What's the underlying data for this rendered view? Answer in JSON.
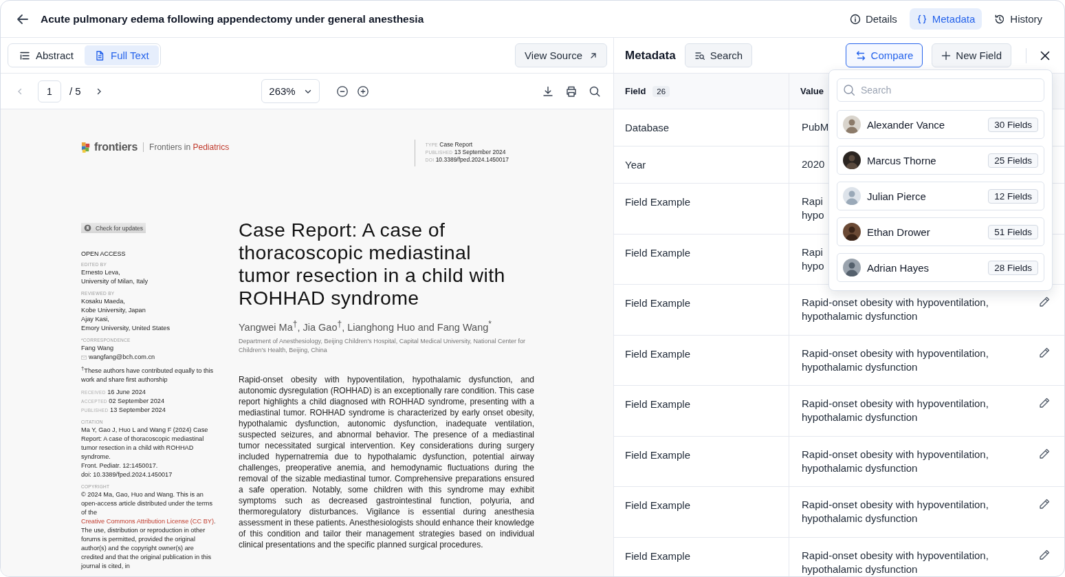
{
  "window": {
    "title": "Acute pulmonary edema following appendectomy under general anesthesia"
  },
  "view_tabs": [
    {
      "label": "Details",
      "selected": false
    },
    {
      "label": "Metadata",
      "selected": true
    },
    {
      "label": "History",
      "selected": false
    }
  ],
  "document_tabs": [
    {
      "label": "Abstract",
      "selected": false
    },
    {
      "label": "Full Text",
      "selected": true
    }
  ],
  "view_source": "View Source",
  "pager": {
    "page": "1",
    "total": "/ 5",
    "zoom": "263%"
  },
  "article": {
    "brand": "frontiers",
    "journal_prefix": "Frontiers in",
    "journal_name": "Pediatrics",
    "meta": [
      {
        "label": "TYPE",
        "value": "Case Report"
      },
      {
        "label": "PUBLISHED",
        "value": "13 September 2024"
      },
      {
        "label": "DOI",
        "value": "10.3389/fped.2024.1450017"
      }
    ],
    "check_updates": "Check for updates",
    "open_access": "OPEN ACCESS",
    "sections": [
      {
        "heading": "EDITED BY",
        "lines": [
          "Ernesto Leva,",
          "University of Milan, Italy"
        ]
      },
      {
        "heading": "REVIEWED BY",
        "lines": [
          "Kosaku Maeda,",
          "Kobe University, Japan",
          "Ajay Kasi,",
          "Emory University, United States"
        ]
      },
      {
        "heading": "*CORRESPONDENCE",
        "lines": [
          "Fang Wang"
        ]
      }
    ],
    "email": "wangfang@bch.com.cn",
    "footnote": "$^{†}$These authors have contributed equally to this work and share first authorship",
    "dates": [
      {
        "label": "RECEIVED",
        "value": "16 June 2024"
      },
      {
        "label": "ACCEPTED",
        "value": "02 September 2024"
      },
      {
        "label": "PUBLISHED",
        "value": "13 September 2024"
      }
    ],
    "citation": {
      "heading": "CITATION",
      "lines": [
        "Ma Y, Gao J, Huo L and Wang F (2024) Case Report: A case of thoracoscopic mediastinal tumor resection in a child with ROHHAD syndrome.",
        "Front. Pediatr. 12:1450017.",
        "doi: 10.3389/fped.2024.1450017"
      ]
    },
    "copyright": {
      "heading": "COPYRIGHT",
      "before": "© 2024 Ma, Gao, Huo and Wang. This is an open-access article distributed under the terms of the",
      "link": "Creative Commons Attribution License (CC BY)",
      "after": ". The use, distribution or reproduction in other forums is permitted, provided the original author(s) and the copyright owner(s) are credited and that the original publication in this journal is cited, in"
    },
    "title": "Case Report: A case of thoracoscopic mediastinal tumor resection in a child with ROHHAD syndrome",
    "authors": "Yangwei Ma$^{†}$, Jia Gao$^{†}$, Lianghong Huo and Fang Wang$^{*}$",
    "affiliation": "Department of Anesthesiology, Beijing Children's Hospital, Capital Medical University, National Center for Children's Health, Beijing, China",
    "abstract": "Rapid-onset obesity with hypoventilation, hypothalamic dysfunction, and autonomic dysregulation (ROHHAD) is an exceptionally rare condition. This case report highlights a child diagnosed with ROHHAD syndrome, presenting with a mediastinal tumor. ROHHAD syndrome is characterized by early onset obesity, hypothalamic dysfunction, autonomic dysfunction, inadequate ventilation, suspected seizures, and abnormal behavior. The presence of a mediastinal tumor necessitated surgical intervention. Key considerations during surgery included hypernatremia due to hypothalamic dysfunction, potential airway challenges, preoperative anemia, and hemodynamic fluctuations during the removal of the sizable mediastinal tumor. Comprehensive preparations ensured a safe operation. Notably, some children with this syndrome may exhibit symptoms such as decreased gastrointestinal function, polyuria, and thermoregulatory disturbances. Vigilance is essential during anesthesia assessment in these patients. Anesthesiologists should enhance their knowledge of this condition and tailor their management strategies based on individual clinical presentations and the specific planned surgical procedures."
  },
  "metadata_panel": {
    "title": "Metadata",
    "search": "Search",
    "compare": {
      "label": "Compare",
      "selected": true
    },
    "new_field": "New Field",
    "columns": [
      {
        "label": "Field",
        "count": "26"
      },
      {
        "label": "Value"
      }
    ],
    "rows": [
      {
        "field": "Database",
        "value_lines": [
          "PubM"
        ]
      },
      {
        "field": "Year",
        "value_lines": [
          "2020"
        ]
      },
      {
        "field": "Field Example",
        "value_lines": [
          "Rapi",
          "hypo"
        ]
      },
      {
        "field": "Field Example",
        "value_lines": [
          "Rapi",
          "hypo"
        ]
      },
      {
        "field": "Field Example",
        "value_lines": [
          "Rapid-onset obesity with hypoventilation,",
          "hypothalamic dysfunction"
        ],
        "editable": true
      },
      {
        "field": "Field Example",
        "value_lines": [
          "Rapid-onset obesity with hypoventilation,",
          "hypothalamic dysfunction"
        ],
        "editable": true
      },
      {
        "field": "Field Example",
        "value_lines": [
          "Rapid-onset obesity with hypoventilation,",
          "hypothalamic dysfunction"
        ],
        "editable": true
      },
      {
        "field": "Field Example",
        "value_lines": [
          "Rapid-onset obesity with hypoventilation,",
          "hypothalamic dysfunction"
        ],
        "editable": true
      },
      {
        "field": "Field Example",
        "value_lines": [
          "Rapid-onset obesity with hypoventilation,",
          "hypothalamic dysfunction"
        ],
        "editable": true
      },
      {
        "field": "Field Example",
        "value_lines": [
          "Rapid-onset obesity with hypoventilation,",
          "hypothalamic dysfunction"
        ],
        "editable": true
      }
    ]
  },
  "compare_menu": {
    "search_placeholder": "Search",
    "people": [
      {
        "name": "Alexander Vance",
        "fields": "30 Fields"
      },
      {
        "name": "Marcus Thorne",
        "fields": "25 Fields"
      },
      {
        "name": "Julian Pierce",
        "fields": "12 Fields"
      },
      {
        "name": "Ethan Drower",
        "fields": "51 Fields"
      },
      {
        "name": "Adrian Hayes",
        "fields": "28 Fields"
      }
    ]
  }
}
